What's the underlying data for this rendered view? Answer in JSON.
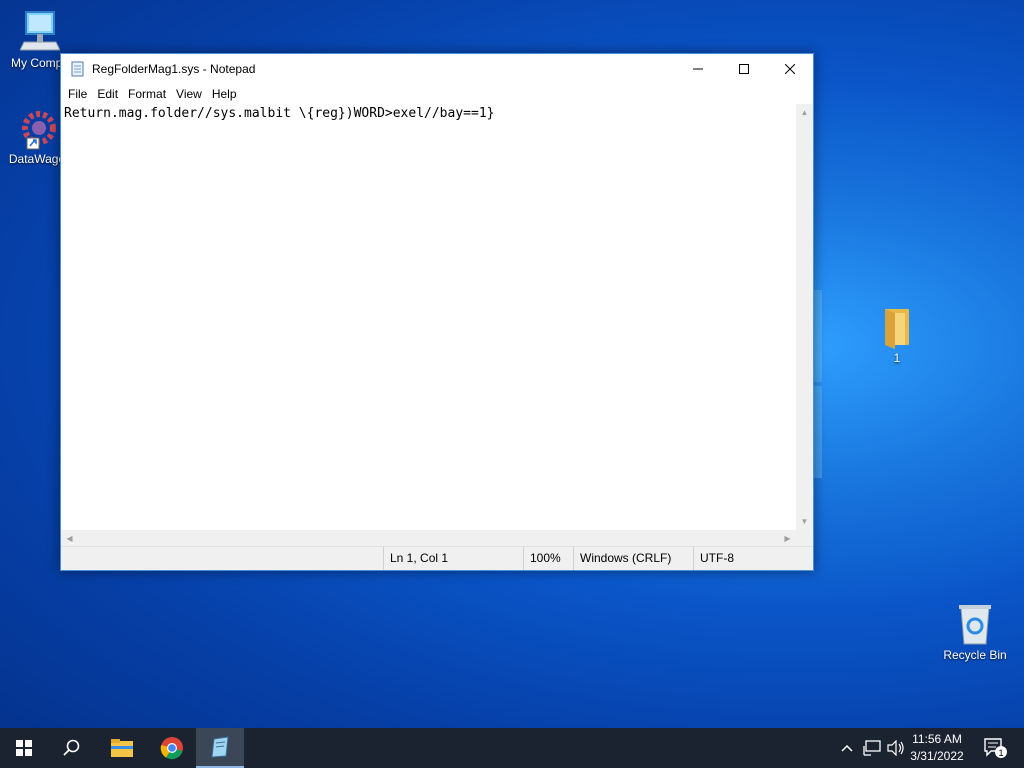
{
  "desktop": {
    "icons": [
      {
        "label": "My Compu"
      },
      {
        "label": "DataWago"
      },
      {
        "label": "1"
      },
      {
        "label": "Recycle Bin"
      }
    ]
  },
  "notepad": {
    "title": "RegFolderMag1.sys - Notepad",
    "menu": [
      "File",
      "Edit",
      "Format",
      "View",
      "Help"
    ],
    "content": "Return.mag.folder//sys.malbit \\{reg})WORD>exel//bay==1}",
    "status": {
      "position": "Ln 1, Col 1",
      "zoom": "100%",
      "line_ending": "Windows (CRLF)",
      "encoding": "UTF-8"
    }
  },
  "taskbar": {
    "apps": [
      "start-icon",
      "search-icon",
      "file-explorer-icon",
      "chrome-icon",
      "notepad-icon"
    ],
    "clock": {
      "time": "11:56 AM",
      "date": "3/31/2022"
    },
    "notification_count": "1"
  }
}
